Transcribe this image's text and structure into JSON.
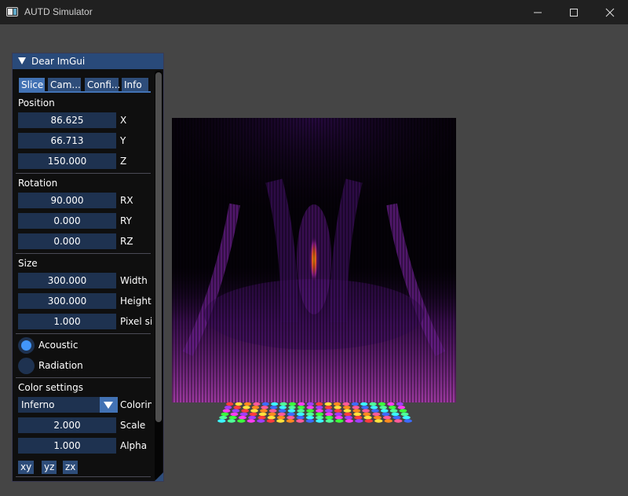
{
  "window": {
    "title": "AUTD Simulator"
  },
  "imgui": {
    "title": "Dear ImGui",
    "tabs": [
      "Slice",
      "Cam...",
      "Confi...",
      "Info"
    ],
    "position": {
      "label": "Position",
      "fields": [
        {
          "value": "86.625",
          "label": "X"
        },
        {
          "value": "66.713",
          "label": "Y"
        },
        {
          "value": "150.000",
          "label": "Z"
        }
      ]
    },
    "rotation": {
      "label": "Rotation",
      "fields": [
        {
          "value": "90.000",
          "label": "RX"
        },
        {
          "value": "0.000",
          "label": "RY"
        },
        {
          "value": "0.000",
          "label": "RZ"
        }
      ]
    },
    "size": {
      "label": "Size",
      "fields": [
        {
          "value": "300.000",
          "label": "Width"
        },
        {
          "value": "300.000",
          "label": "Height"
        },
        {
          "value": "1.000",
          "label": "Pixel size"
        }
      ]
    },
    "field_type": {
      "options": [
        "Acoustic",
        "Radiation"
      ],
      "selected": "Acoustic"
    },
    "color": {
      "label": "Color settings",
      "colormap": "Inferno",
      "colormap_label": "Coloring",
      "fields": [
        {
          "value": "2.000",
          "label": "Scale"
        },
        {
          "value": "1.000",
          "label": "Alpha"
        }
      ]
    },
    "plane_buttons": [
      "xy",
      "yz",
      "zx"
    ]
  },
  "viewport": {
    "colormap": "inferno"
  },
  "colors": {
    "accent": "#4296fa",
    "tab_active": "#4272b4",
    "frame_bg": "#1e3250",
    "title_bg": "#294a7a"
  }
}
